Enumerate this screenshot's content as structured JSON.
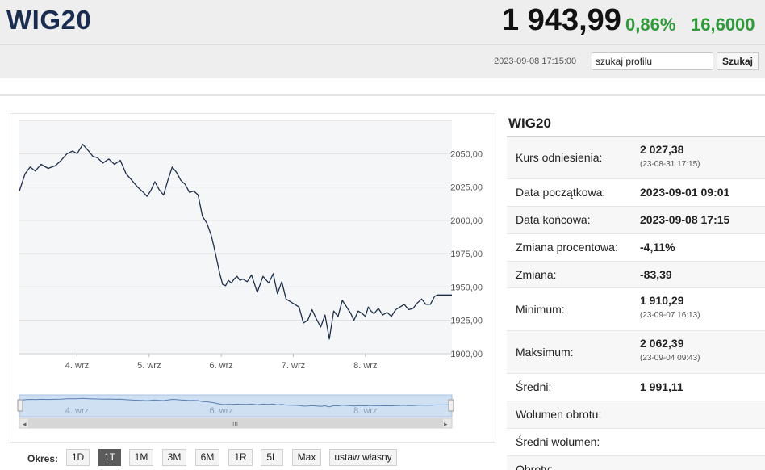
{
  "header": {
    "index_name": "WIG20",
    "price": "1 943,99",
    "change_pct": "0,86%",
    "change_abs": "16,6000",
    "timestamp": "2023-09-08 17:15:00",
    "search_value": "szukaj profilu",
    "search_button": "Szukaj"
  },
  "colors": {
    "brand": "#1a2d50",
    "positive": "#2e9a3a",
    "line": "#1f2e4a",
    "navigator_fill": "#cfe0f3",
    "active_button": "#5b5b5b"
  },
  "chart_data": {
    "type": "line",
    "title": "",
    "xlabel": "",
    "ylabel": "",
    "ylim": [
      1900,
      2075
    ],
    "yticks": [
      "2050,00",
      "2025,00",
      "2000,00",
      "1975,00",
      "1950,00",
      "1925,00",
      "1900,00"
    ],
    "ytick_values": [
      2050,
      2025,
      2000,
      1975,
      1950,
      1925,
      1900
    ],
    "xlim": [
      3.2,
      9.2
    ],
    "xticks": [
      "4. wrz",
      "5. wrz",
      "6. wrz",
      "7. wrz",
      "8. wrz"
    ],
    "xtick_values": [
      4,
      5,
      6,
      7,
      8
    ],
    "grid": true,
    "series": [
      {
        "x": [
          3.2,
          3.28,
          3.35,
          3.42,
          3.5,
          3.6,
          3.7,
          3.78,
          3.86,
          3.94,
          4.0,
          4.08,
          4.16,
          4.22,
          4.28,
          4.36,
          4.44,
          4.52,
          4.6,
          4.68,
          4.76,
          4.84,
          4.92,
          4.97,
          5.02,
          5.08,
          5.14,
          5.2,
          5.26,
          5.32,
          5.38,
          5.44,
          5.5,
          5.56,
          5.62,
          5.68,
          5.74,
          5.8,
          5.86,
          5.9,
          5.94,
          5.98,
          6.02,
          6.06,
          6.1,
          6.14,
          6.18,
          6.22,
          6.26,
          6.3,
          6.36,
          6.42,
          6.5,
          6.58,
          6.66,
          6.72,
          6.78,
          6.84,
          6.9,
          6.96,
          7.02,
          7.08,
          7.14,
          7.2,
          7.26,
          7.32,
          7.38,
          7.44,
          7.5,
          7.56,
          7.62,
          7.68,
          7.74,
          7.8,
          7.84,
          7.9,
          7.96,
          8.0,
          8.04,
          8.08,
          8.12,
          8.18,
          8.24,
          8.3,
          8.36,
          8.42,
          8.48,
          8.54,
          8.6,
          8.66,
          8.72,
          8.78,
          8.84,
          8.9,
          8.96,
          9.0,
          9.06,
          9.12,
          9.2
        ],
        "y": [
          2022,
          2035,
          2040,
          2037,
          2042,
          2039,
          2041,
          2045,
          2050,
          2052,
          2050,
          2057,
          2052,
          2048,
          2047,
          2043,
          2046,
          2042,
          2045,
          2035,
          2030,
          2025,
          2021,
          2018,
          2022,
          2029,
          2023,
          2019,
          2030,
          2040,
          2036,
          2030,
          2027,
          2021,
          2022,
          2019,
          2003,
          1998,
          1989,
          1980,
          1970,
          1960,
          1952,
          1951,
          1955,
          1953,
          1956,
          1958,
          1955,
          1956,
          1954,
          1959,
          1946,
          1958,
          1953,
          1960,
          1945,
          1954,
          1941,
          1939,
          1937,
          1935,
          1923,
          1925,
          1933,
          1926,
          1920,
          1929,
          1911,
          1932,
          1928,
          1940,
          1935,
          1930,
          1925,
          1932,
          1930,
          1928,
          1935,
          1932,
          1930,
          1934,
          1929,
          1931,
          1928,
          1933,
          1935,
          1937,
          1933,
          1934,
          1938,
          1941,
          1937,
          1937,
          1943,
          1944,
          1944,
          1944,
          1944
        ]
      }
    ],
    "navigator": {
      "xticks": [
        "4. wrz",
        "6. wrz",
        "8. wrz"
      ]
    }
  },
  "okres": {
    "label": "Okres:",
    "buttons": [
      {
        "label": "1D"
      },
      {
        "label": "1T"
      },
      {
        "label": "1M"
      },
      {
        "label": "3M"
      },
      {
        "label": "6M"
      },
      {
        "label": "1R"
      },
      {
        "label": "5L"
      },
      {
        "label": "Max"
      },
      {
        "label": "ustaw własny"
      }
    ],
    "active": "1T"
  },
  "stats": {
    "title": "WIG20",
    "rows": [
      {
        "label": "Kurs odniesienia:",
        "value": "2 027,38",
        "sub": "(23-08-31 17:15)"
      },
      {
        "label": "Data początkowa:",
        "value": "2023-09-01 09:01",
        "sub": ""
      },
      {
        "label": "Data końcowa:",
        "value": "2023-09-08 17:15",
        "sub": ""
      },
      {
        "label": "Zmiana procentowa:",
        "value": "-4,11%",
        "sub": ""
      },
      {
        "label": "Zmiana:",
        "value": "-83,39",
        "sub": ""
      },
      {
        "label": "Minimum:",
        "value": "1 910,29",
        "sub": "(23-09-07 16:13)"
      },
      {
        "label": "Maksimum:",
        "value": "2 062,39",
        "sub": "(23-09-04 09:43)"
      },
      {
        "label": "Średni:",
        "value": "1 991,11",
        "sub": ""
      },
      {
        "label": "Wolumen obrotu:",
        "value": "",
        "sub": ""
      },
      {
        "label": "Średni wolumen:",
        "value": "",
        "sub": ""
      },
      {
        "label": "Obroty:",
        "value": "",
        "sub": ""
      }
    ]
  }
}
